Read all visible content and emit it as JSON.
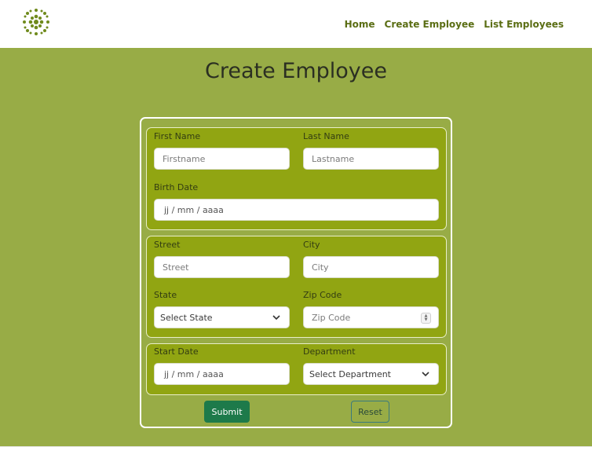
{
  "nav": {
    "links": [
      "Home",
      "Create Employee",
      "List Employees"
    ]
  },
  "page": {
    "title": "Create Employee"
  },
  "form": {
    "first_name": {
      "label": "First Name",
      "placeholder": "Firstname"
    },
    "last_name": {
      "label": "Last Name",
      "placeholder": "Lastname"
    },
    "birth_date": {
      "label": "Birth Date",
      "placeholder": "jj / mm / aaaa"
    },
    "street": {
      "label": "Street",
      "placeholder": "Street"
    },
    "city": {
      "label": "City",
      "placeholder": "City"
    },
    "state": {
      "label": "State",
      "value": "Select State"
    },
    "zip": {
      "label": "Zip Code",
      "placeholder": "Zip Code"
    },
    "start_date": {
      "label": "Start Date",
      "placeholder": "jj / mm / aaaa"
    },
    "department": {
      "label": "Department",
      "value": "Select Department"
    },
    "submit_label": "Submit",
    "reset_label": "Reset"
  },
  "colors": {
    "background": "#98ac46",
    "fieldset": "#91a512",
    "nav_link": "#5b6e14",
    "submit": "#1d7a4a"
  },
  "icons": {
    "logo": "green-flower-logo",
    "select": "chevron-down-icon",
    "number": "spinner-icon"
  }
}
